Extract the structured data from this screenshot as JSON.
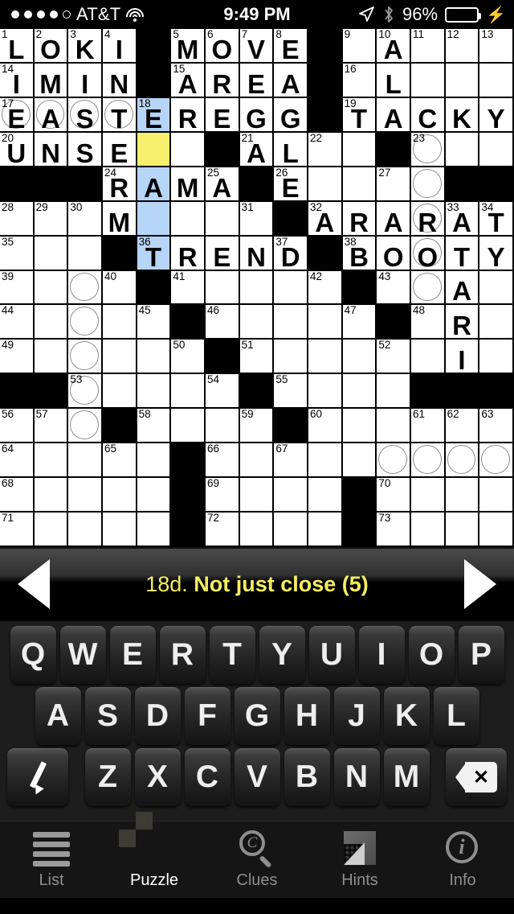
{
  "status_bar": {
    "signal_dots": [
      true,
      true,
      true,
      true,
      false
    ],
    "carrier": "AT&T",
    "wifi_icon": "wifi-icon",
    "time": "9:49 PM",
    "location_icon": "location-arrow-icon",
    "bluetooth_icon": "bluetooth-icon",
    "battery_percent": "96%",
    "battery_level": 96,
    "battery_color": "#4cd964",
    "charging_icon": "lightning-bolt-icon"
  },
  "grid": {
    "rows": 15,
    "cols": 15,
    "highlight_color": "#b7d5f7",
    "cursor_color": "#f7ef6e",
    "cells": [
      [
        {
          "n": "1",
          "l": "L"
        },
        {
          "n": "2",
          "l": "O"
        },
        {
          "n": "3",
          "l": "K"
        },
        {
          "n": "4",
          "l": "I"
        },
        {
          "b": true
        },
        {
          "n": "5",
          "l": "M"
        },
        {
          "n": "6",
          "l": "O"
        },
        {
          "n": "7",
          "l": "V"
        },
        {
          "n": "8",
          "l": "E"
        },
        {
          "b": true
        },
        {
          "n": "9",
          "l": ""
        },
        {
          "n": "10",
          "l": "A"
        },
        {
          "n": "11",
          "l": ""
        },
        {
          "n": "12",
          "l": ""
        },
        {
          "n": "13",
          "l": ""
        }
      ],
      [
        {
          "n": "14",
          "l": "I"
        },
        {
          "l": "M"
        },
        {
          "l": "I"
        },
        {
          "l": "N"
        },
        {
          "b": true
        },
        {
          "n": "15",
          "l": "A"
        },
        {
          "l": "R"
        },
        {
          "l": "E"
        },
        {
          "l": "A"
        },
        {
          "b": true
        },
        {
          "n": "16",
          "l": ""
        },
        {
          "l": "L"
        },
        {
          "l": ""
        },
        {
          "l": ""
        },
        {
          "l": ""
        }
      ],
      [
        {
          "n": "17",
          "l": "E",
          "c": true
        },
        {
          "l": "A",
          "c": true
        },
        {
          "l": "S",
          "c": true
        },
        {
          "l": "T",
          "c": true
        },
        {
          "n": "18",
          "l": "E",
          "h": true
        },
        {
          "l": "R"
        },
        {
          "l": "E"
        },
        {
          "l": "G"
        },
        {
          "l": "G"
        },
        {
          "b": true
        },
        {
          "n": "19",
          "l": "T"
        },
        {
          "l": "A"
        },
        {
          "l": "C"
        },
        {
          "l": "K"
        },
        {
          "l": "Y"
        }
      ],
      [
        {
          "n": "20",
          "l": "U"
        },
        {
          "l": "N"
        },
        {
          "l": "S"
        },
        {
          "l": "E"
        },
        {
          "l": "",
          "cur": true
        },
        {
          "l": ""
        },
        {
          "b": true
        },
        {
          "n": "21",
          "l": "A"
        },
        {
          "l": "L"
        },
        {
          "n": "22",
          "l": ""
        },
        {
          "l": ""
        },
        {
          "b": true
        },
        {
          "n": "23",
          "l": "",
          "c": true
        },
        {
          "l": ""
        },
        {
          "l": ""
        }
      ],
      [
        {
          "b": true
        },
        {
          "b": true
        },
        {
          "b": true
        },
        {
          "n": "24",
          "l": "R"
        },
        {
          "l": "A",
          "h": true
        },
        {
          "l": "M"
        },
        {
          "n": "25",
          "l": "A"
        },
        {
          "b": true
        },
        {
          "n": "26",
          "l": "E"
        },
        {
          "l": ""
        },
        {
          "l": ""
        },
        {
          "n": "27",
          "l": ""
        },
        {
          "l": "",
          "c": true
        },
        {
          "b": true
        },
        {
          "b": true
        }
      ],
      [
        {
          "n": "28",
          "l": ""
        },
        {
          "n": "29",
          "l": ""
        },
        {
          "n": "30",
          "l": ""
        },
        {
          "l": "M"
        },
        {
          "l": "",
          "h": true
        },
        {
          "l": ""
        },
        {
          "l": ""
        },
        {
          "n": "31",
          "l": ""
        },
        {
          "b": true
        },
        {
          "n": "32",
          "l": "A"
        },
        {
          "l": "R"
        },
        {
          "l": "A"
        },
        {
          "l": "R",
          "c": true
        },
        {
          "n": "33",
          "l": "A"
        },
        {
          "n": "34",
          "l": "T"
        }
      ],
      [
        {
          "n": "35",
          "l": ""
        },
        {
          "l": ""
        },
        {
          "l": ""
        },
        {
          "b": true
        },
        {
          "n": "36",
          "l": "T",
          "h": true
        },
        {
          "l": "R"
        },
        {
          "l": "E"
        },
        {
          "l": "N"
        },
        {
          "n": "37",
          "l": "D"
        },
        {
          "b": true
        },
        {
          "n": "38",
          "l": "B"
        },
        {
          "l": "O"
        },
        {
          "l": "O",
          "c": true
        },
        {
          "l": "T"
        },
        {
          "l": "Y"
        }
      ],
      [
        {
          "n": "39",
          "l": ""
        },
        {
          "l": ""
        },
        {
          "l": "",
          "c": true
        },
        {
          "n": "40",
          "l": ""
        },
        {
          "b": true
        },
        {
          "n": "41",
          "l": ""
        },
        {
          "l": ""
        },
        {
          "l": ""
        },
        {
          "l": ""
        },
        {
          "n": "42",
          "l": ""
        },
        {
          "b": true
        },
        {
          "n": "43",
          "l": ""
        },
        {
          "l": "",
          "c": true
        },
        {
          "l": "A"
        },
        {
          "l": ""
        }
      ],
      [
        {
          "n": "44",
          "l": ""
        },
        {
          "l": ""
        },
        {
          "l": "",
          "c": true
        },
        {
          "l": ""
        },
        {
          "n": "45",
          "l": ""
        },
        {
          "b": true
        },
        {
          "n": "46",
          "l": ""
        },
        {
          "l": ""
        },
        {
          "l": ""
        },
        {
          "l": ""
        },
        {
          "n": "47",
          "l": ""
        },
        {
          "b": true
        },
        {
          "n": "48",
          "l": ""
        },
        {
          "l": "R"
        },
        {
          "l": ""
        }
      ],
      [
        {
          "n": "49",
          "l": ""
        },
        {
          "l": ""
        },
        {
          "l": "",
          "c": true
        },
        {
          "l": ""
        },
        {
          "l": ""
        },
        {
          "n": "50",
          "l": ""
        },
        {
          "b": true
        },
        {
          "n": "51",
          "l": ""
        },
        {
          "l": ""
        },
        {
          "l": ""
        },
        {
          "l": ""
        },
        {
          "n": "52",
          "l": ""
        },
        {
          "l": ""
        },
        {
          "l": "I"
        },
        {
          "l": ""
        }
      ],
      [
        {
          "b": true
        },
        {
          "b": true
        },
        {
          "n": "53",
          "l": "",
          "c": true
        },
        {
          "l": ""
        },
        {
          "l": ""
        },
        {
          "l": ""
        },
        {
          "n": "54",
          "l": ""
        },
        {
          "b": true
        },
        {
          "n": "55",
          "l": ""
        },
        {
          "l": ""
        },
        {
          "l": ""
        },
        {
          "l": ""
        },
        {
          "b": true
        },
        {
          "b": true
        },
        {
          "b": true
        }
      ],
      [
        {
          "n": "56",
          "l": ""
        },
        {
          "n": "57",
          "l": ""
        },
        {
          "l": "",
          "c": true
        },
        {
          "b": true
        },
        {
          "n": "58",
          "l": ""
        },
        {
          "l": ""
        },
        {
          "l": ""
        },
        {
          "n": "59",
          "l": ""
        },
        {
          "b": true
        },
        {
          "n": "60",
          "l": ""
        },
        {
          "l": ""
        },
        {
          "l": ""
        },
        {
          "n": "61",
          "l": ""
        },
        {
          "n": "62",
          "l": ""
        },
        {
          "n": "63",
          "l": ""
        }
      ],
      [
        {
          "n": "64",
          "l": ""
        },
        {
          "l": ""
        },
        {
          "l": ""
        },
        {
          "n": "65",
          "l": ""
        },
        {
          "l": ""
        },
        {
          "b": true
        },
        {
          "n": "66",
          "l": ""
        },
        {
          "l": ""
        },
        {
          "n": "67",
          "l": ""
        },
        {
          "l": ""
        },
        {
          "l": ""
        },
        {
          "l": "",
          "c": true
        },
        {
          "l": "",
          "c": true
        },
        {
          "l": "",
          "c": true
        },
        {
          "l": "",
          "c": true
        }
      ],
      [
        {
          "n": "68",
          "l": ""
        },
        {
          "l": ""
        },
        {
          "l": ""
        },
        {
          "l": ""
        },
        {
          "l": ""
        },
        {
          "b": true
        },
        {
          "n": "69",
          "l": ""
        },
        {
          "l": ""
        },
        {
          "l": ""
        },
        {
          "l": ""
        },
        {
          "b": true
        },
        {
          "n": "70",
          "l": ""
        },
        {
          "l": ""
        },
        {
          "l": ""
        },
        {
          "l": ""
        }
      ],
      [
        {
          "n": "71",
          "l": ""
        },
        {
          "l": ""
        },
        {
          "l": ""
        },
        {
          "l": ""
        },
        {
          "l": ""
        },
        {
          "b": true
        },
        {
          "n": "72",
          "l": ""
        },
        {
          "l": ""
        },
        {
          "l": ""
        },
        {
          "l": ""
        },
        {
          "b": true
        },
        {
          "n": "73",
          "l": ""
        },
        {
          "l": ""
        },
        {
          "l": ""
        },
        {
          "l": ""
        }
      ]
    ]
  },
  "clue_bar": {
    "prev_label": "prev-clue-arrow",
    "next_label": "next-clue-arrow",
    "number": "18d.",
    "text": "Not just close (5)",
    "color": "#f6ee5e"
  },
  "keyboard": {
    "row1": [
      "Q",
      "W",
      "E",
      "R",
      "T",
      "Y",
      "U",
      "I",
      "O",
      "P"
    ],
    "row2": [
      "A",
      "S",
      "D",
      "F",
      "G",
      "H",
      "J",
      "K",
      "L"
    ],
    "row3": [
      "Z",
      "X",
      "C",
      "V",
      "B",
      "N",
      "M"
    ],
    "pen_key": "pencil-icon",
    "delete_key": "backspace-icon"
  },
  "tab_bar": {
    "tabs": [
      {
        "label": "List",
        "icon": "list-icon",
        "active": false
      },
      {
        "label": "Puzzle",
        "icon": "checkerboard-icon",
        "active": true
      },
      {
        "label": "Clues",
        "icon": "magnifier-c-icon",
        "active": false
      },
      {
        "label": "Hints",
        "icon": "page-fold-icon",
        "active": false
      },
      {
        "label": "Info",
        "icon": "info-circle-icon",
        "active": false
      }
    ]
  }
}
